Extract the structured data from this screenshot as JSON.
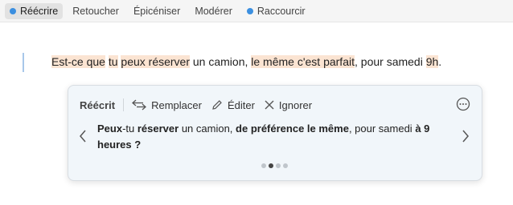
{
  "toolbar": {
    "items": [
      {
        "label": "Réécrire",
        "dot": true,
        "active": true
      },
      {
        "label": "Retoucher",
        "dot": false
      },
      {
        "label": "Épicéniser",
        "dot": false
      },
      {
        "label": "Modérer",
        "dot": false
      },
      {
        "label": "Raccourcir",
        "dot": true
      }
    ]
  },
  "document": {
    "segments": [
      {
        "text": "Est-ce que",
        "hl": true
      },
      {
        "text": " ",
        "hl": false
      },
      {
        "text": "tu",
        "hl": true
      },
      {
        "text": " ",
        "hl": false
      },
      {
        "text": "peux réserver",
        "hl": true
      },
      {
        "text": " un camion, ",
        "hl": false
      },
      {
        "text": "le même c'est parfait",
        "hl": true
      },
      {
        "text": ", pour samedi ",
        "hl": false
      },
      {
        "text": "9h",
        "hl": true
      },
      {
        "text": ".",
        "hl": false
      }
    ]
  },
  "popover": {
    "title": "Réécrit",
    "replace_label": "Remplacer",
    "edit_label": "Éditer",
    "ignore_label": "Ignorer",
    "suggestion": [
      {
        "text": "Peux",
        "bold": true
      },
      {
        "text": "-tu ",
        "bold": false
      },
      {
        "text": "réserver",
        "bold": true
      },
      {
        "text": " un camion, ",
        "bold": false
      },
      {
        "text": "de préférence le même",
        "bold": true
      },
      {
        "text": ", pour samedi ",
        "bold": false
      },
      {
        "text": "à 9 heures",
        "bold": true
      },
      {
        "text": " ?",
        "bold": true
      }
    ],
    "page_count": 4,
    "current_page": 2
  },
  "colors": {
    "accent_dot": "#3b8fe0",
    "highlight": "#fbe4d2",
    "popover_bg": "#f1f6fa"
  }
}
